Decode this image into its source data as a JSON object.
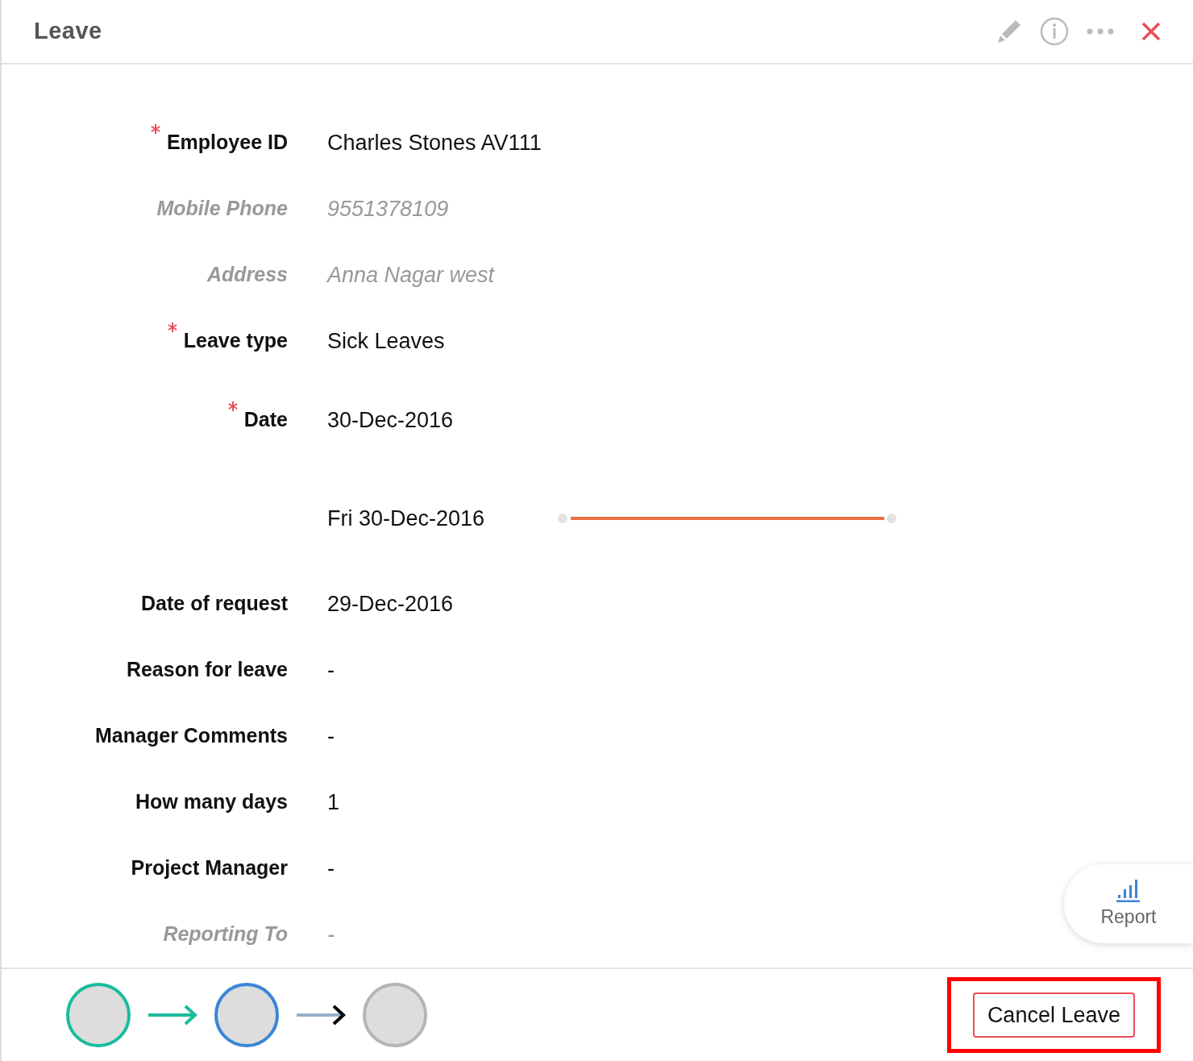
{
  "window": {
    "title": "Leave"
  },
  "fields": [
    {
      "kind": "field",
      "label": "Employee ID",
      "value": "Charles Stones AV111",
      "required": true,
      "muted": false
    },
    {
      "kind": "field",
      "label": "Mobile Phone",
      "value": "9551378109",
      "required": false,
      "muted": true
    },
    {
      "kind": "field",
      "label": "Address",
      "value": "Anna Nagar west",
      "required": false,
      "muted": true
    },
    {
      "kind": "field",
      "label": "Leave type",
      "value": "Sick Leaves",
      "required": true,
      "muted": false
    },
    {
      "kind": "field",
      "label": "Date",
      "value": "30-Dec-2016",
      "required": true,
      "muted": false
    },
    {
      "kind": "timeline",
      "value": "Fri 30-Dec-2016"
    },
    {
      "kind": "field",
      "label": "Date of request",
      "value": "29-Dec-2016",
      "required": false,
      "muted": false
    },
    {
      "kind": "field",
      "label": "Reason for leave",
      "value": "-",
      "required": false,
      "muted": false
    },
    {
      "kind": "field",
      "label": "Manager Comments",
      "value": "-",
      "required": false,
      "muted": false
    },
    {
      "kind": "field",
      "label": "How many days",
      "value": "1",
      "required": false,
      "muted": false
    },
    {
      "kind": "field",
      "label": "Project Manager",
      "value": "-",
      "required": false,
      "muted": false
    },
    {
      "kind": "field",
      "label": "Reporting To",
      "value": "-",
      "required": false,
      "muted": true
    }
  ],
  "report_button": {
    "label": "Report"
  },
  "approval_flow": [
    {
      "color": "#1abc9c"
    },
    {
      "color": "#3a86d8"
    },
    {
      "color": "#b5b5b5"
    }
  ],
  "cancel_button": {
    "label": "Cancel Leave",
    "highlighted": true
  }
}
